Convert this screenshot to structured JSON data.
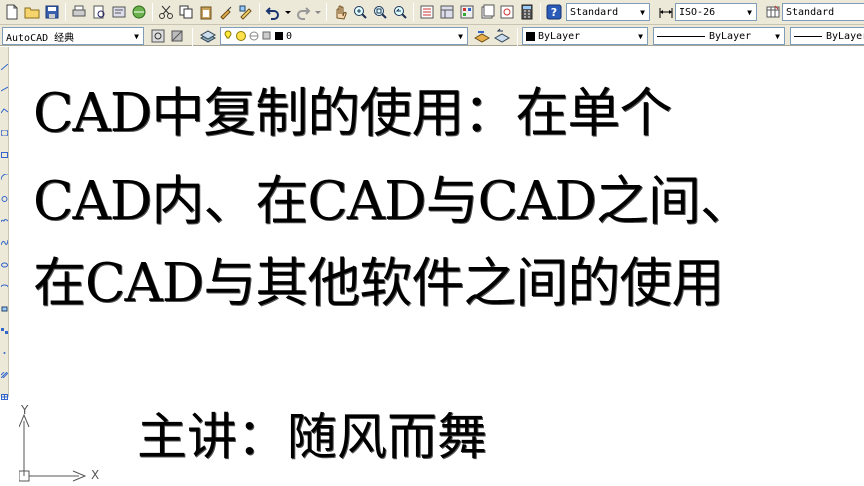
{
  "toolbar_top": {
    "text_style": "Standard",
    "dim_style": "ISO-26",
    "table_style": "Standard"
  },
  "toolbar_layers": {
    "workspace": "AutoCAD 经典",
    "current_layer": "0",
    "color": "ByLayer",
    "linetype": "ByLayer",
    "lineweight": "ByLayer"
  },
  "drawing": {
    "line1": "CAD中复制的使用：在单个",
    "line2": "CAD内、在CAD与CAD之间、",
    "line3": "在CAD与其他软件之间的使用",
    "presenter": "主讲：随风而舞"
  },
  "ucs": {
    "x_label": "X",
    "y_label": "Y"
  },
  "colors": {
    "toolbar_bg": "#ece9d8",
    "canvas_bg": "#ffffff",
    "text": "#000000"
  }
}
